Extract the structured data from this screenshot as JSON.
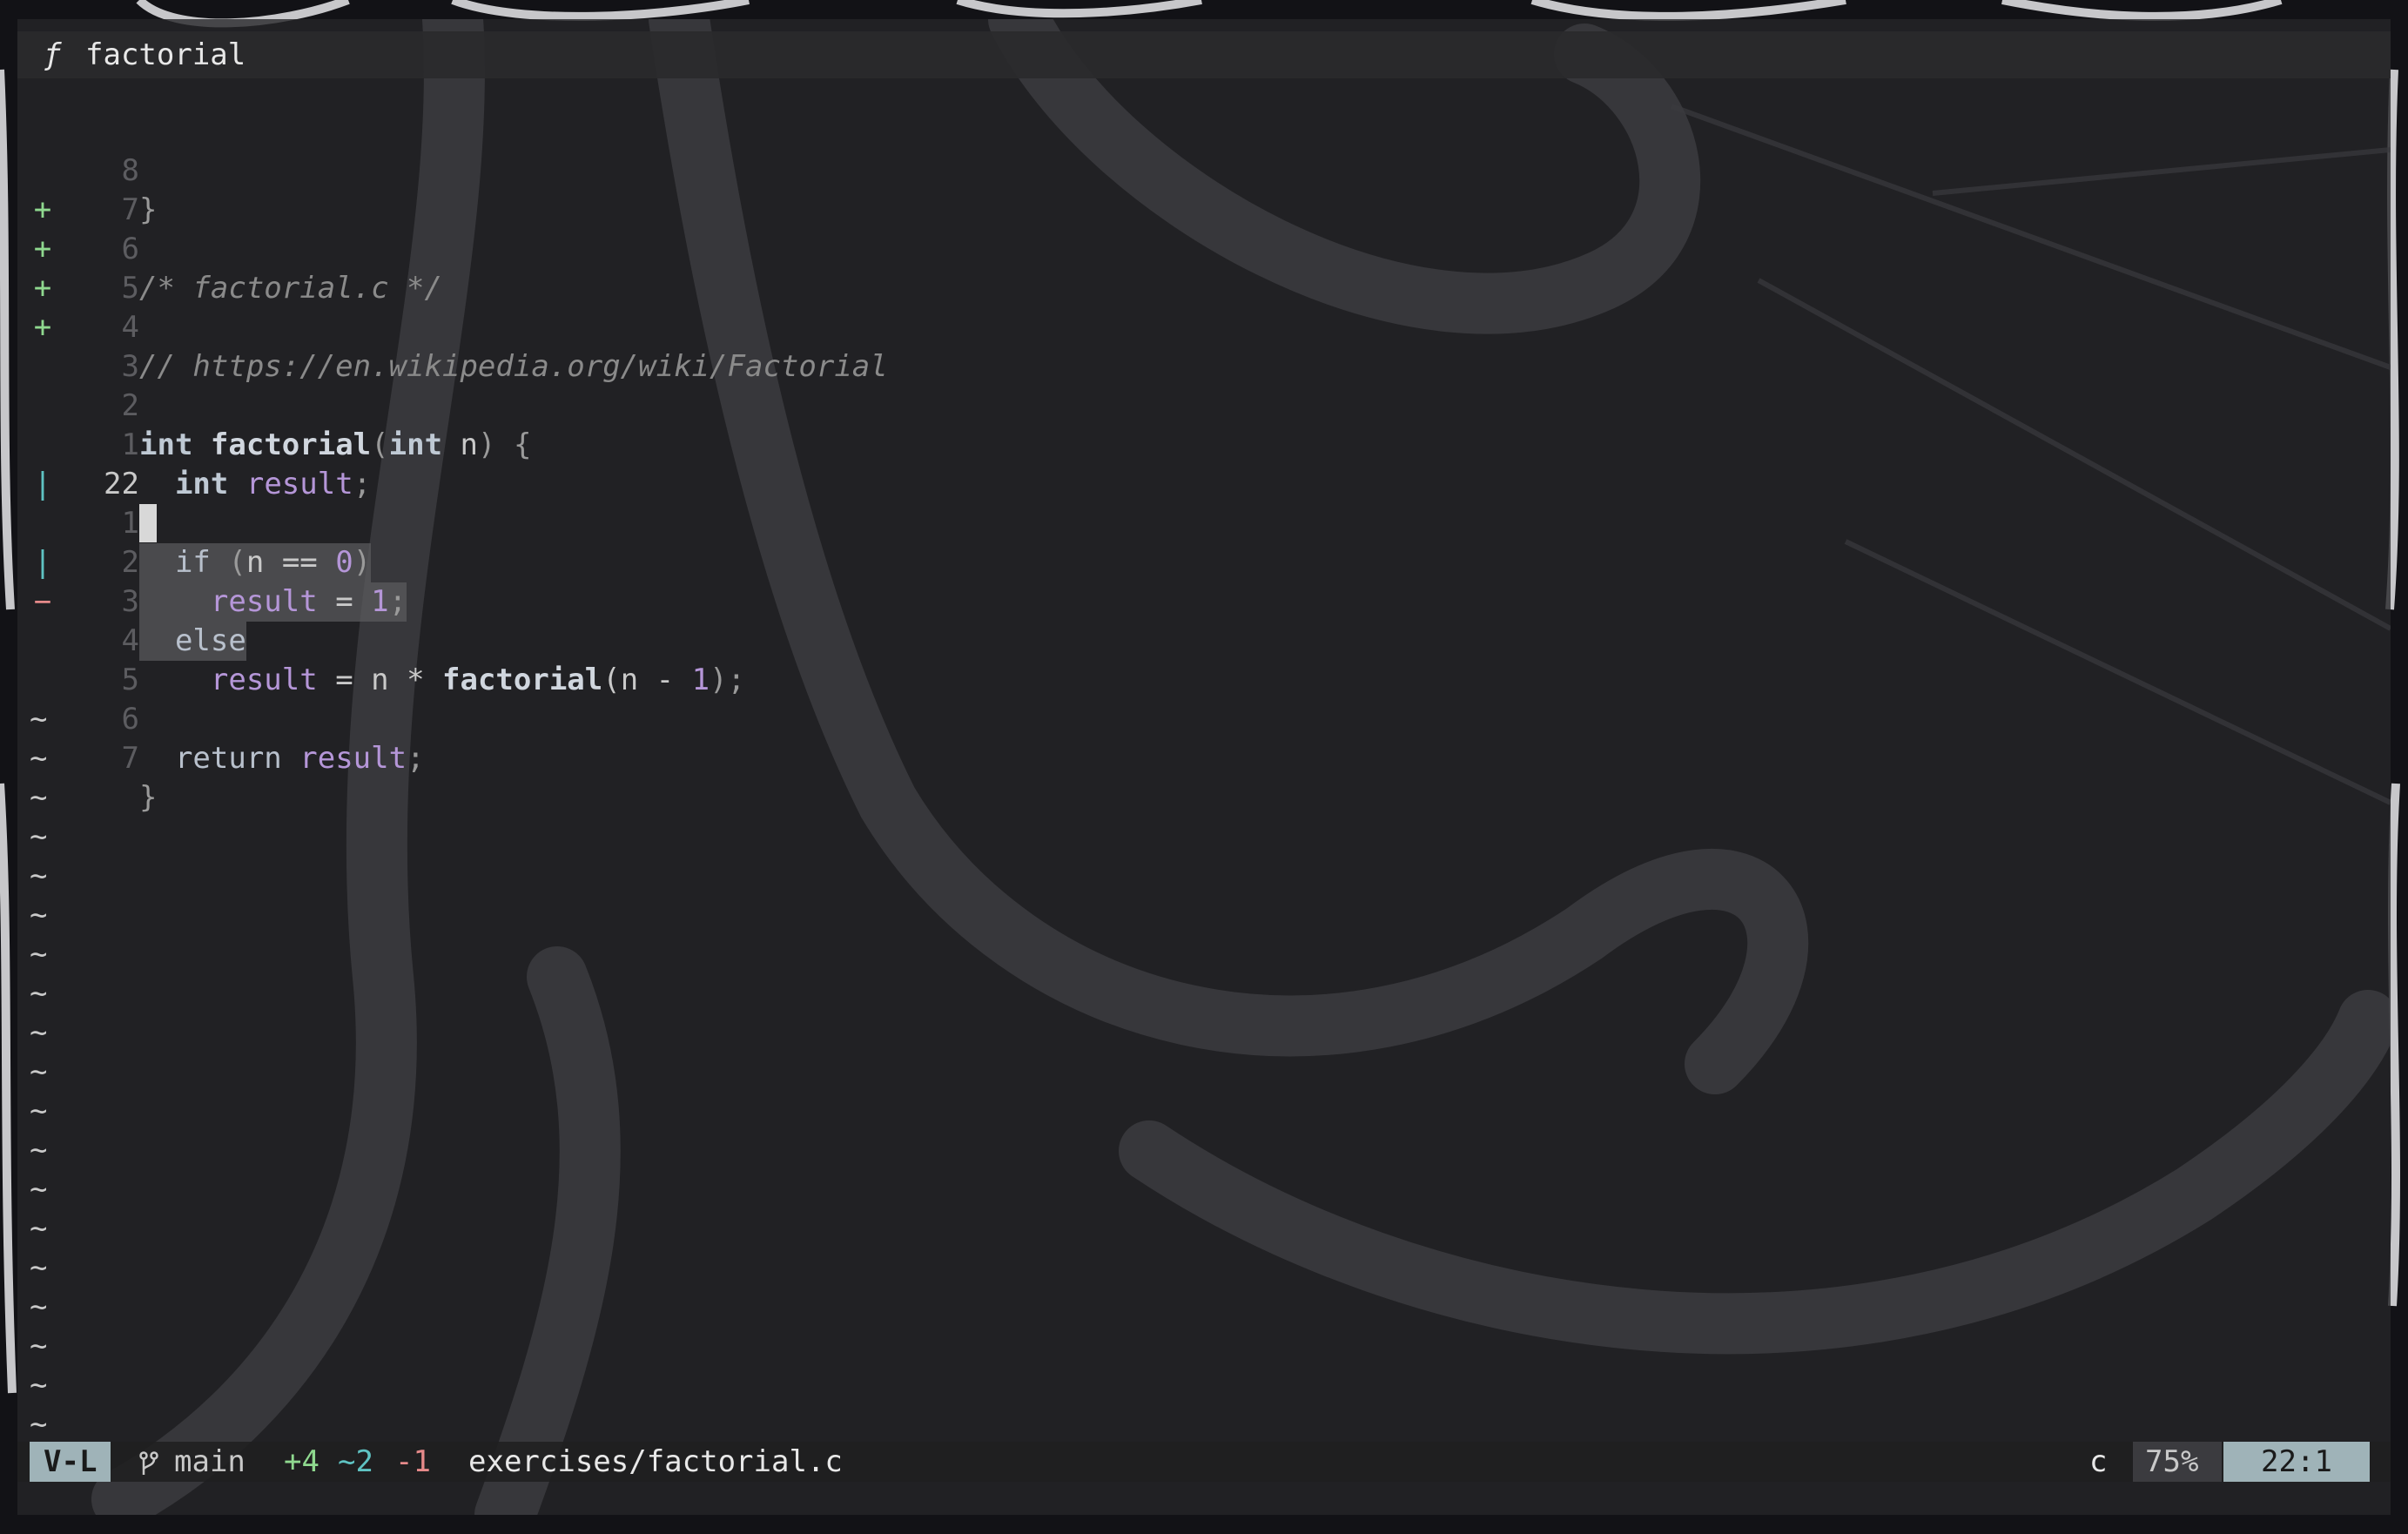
{
  "winbar": {
    "icon": "ƒ",
    "symbol": "factorial"
  },
  "lines": [
    {
      "sign": "",
      "sign_type": "",
      "num": "8",
      "current": false
    },
    {
      "sign": "",
      "sign_type": "",
      "num": "7",
      "current": false
    },
    {
      "sign": "+",
      "sign_type": "add",
      "num": "6",
      "current": false
    },
    {
      "sign": "+",
      "sign_type": "add",
      "num": "5",
      "current": false
    },
    {
      "sign": "+",
      "sign_type": "add",
      "num": "4",
      "current": false
    },
    {
      "sign": "+",
      "sign_type": "add",
      "num": "3",
      "current": false
    },
    {
      "sign": "",
      "sign_type": "",
      "num": "2",
      "current": false
    },
    {
      "sign": "",
      "sign_type": "",
      "num": "1",
      "current": false
    },
    {
      "sign": "",
      "sign_type": "",
      "num": "22",
      "current": true
    },
    {
      "sign": "|",
      "sign_type": "chg",
      "num": "1",
      "current": false
    },
    {
      "sign": "",
      "sign_type": "",
      "num": "2",
      "current": false
    },
    {
      "sign": "|",
      "sign_type": "chg",
      "num": "3",
      "current": false
    },
    {
      "sign": "−",
      "sign_type": "del",
      "num": "4",
      "current": false
    },
    {
      "sign": "",
      "sign_type": "",
      "num": "5",
      "current": false
    },
    {
      "sign": "",
      "sign_type": "",
      "num": "6",
      "current": false
    },
    {
      "sign": "",
      "sign_type": "",
      "num": "7",
      "current": false
    }
  ],
  "code": {
    "l0": "}",
    "l2": "/* factorial.c */",
    "l4": "// https://en.wikipedia.org/wiki/Factorial",
    "l6": {
      "kw1": "int",
      "fn": "factorial",
      "p1": "(",
      "kw2": "int",
      "arg": "n",
      "p2": ") {"
    },
    "l7": {
      "kw": "int",
      "var": "result",
      "end": ";"
    },
    "l9": {
      "kw": "if",
      "p1": " (",
      "v": "n",
      "op": " == ",
      "num": "0",
      "p2": ")"
    },
    "l10": {
      "var": "result",
      "op": " = ",
      "num": "1",
      "end": ";"
    },
    "l11": {
      "kw": "else"
    },
    "l12": {
      "var": "result",
      "op": " = n * ",
      "fn": "factorial",
      "p1": "(n - ",
      "num": "1",
      "p2": ");"
    },
    "l14": {
      "kw": "return",
      "var": "result",
      "end": ";"
    },
    "l15": "}"
  },
  "tilde": "~",
  "tilde_count": 19,
  "status": {
    "mode": "V-L",
    "branch_icon": "branch-icon",
    "branch": "main",
    "diff_added": "+4",
    "diff_changed": "~2",
    "diff_removed": "-1",
    "file": "exercises/factorial.c",
    "filetype": "c",
    "percent": "75%",
    "position": "22:1"
  },
  "colors": {
    "added": "#8fd98f",
    "changed": "#5fc3c3",
    "removed": "#e68a8a",
    "mode_bg": "#9fb3b8",
    "variable": "#b596d8"
  }
}
